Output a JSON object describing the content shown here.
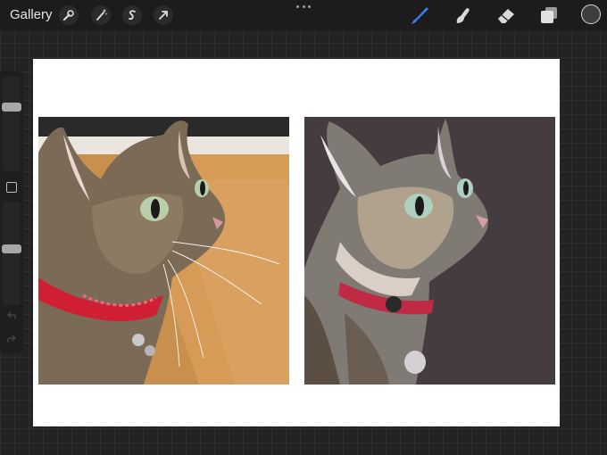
{
  "topbar": {
    "gallery_label": "Gallery",
    "tools": [
      "wrench-icon",
      "magic-wand-icon",
      "selection-icon",
      "transform-icon"
    ],
    "right_tools": [
      "brush-icon",
      "smudge-icon",
      "eraser-icon",
      "layers-icon"
    ],
    "active_tool": "brush-icon",
    "accent_color": "#3d7bf5",
    "current_color": "#3c3f3b"
  },
  "sidebar": {
    "brush_size": 0.7,
    "opacity": 0.55,
    "icons": [
      "modify-square-icon",
      "undo-icon",
      "redo-icon"
    ]
  },
  "canvas": {
    "background": "#ffffff",
    "painting_background": "#453c3f"
  }
}
